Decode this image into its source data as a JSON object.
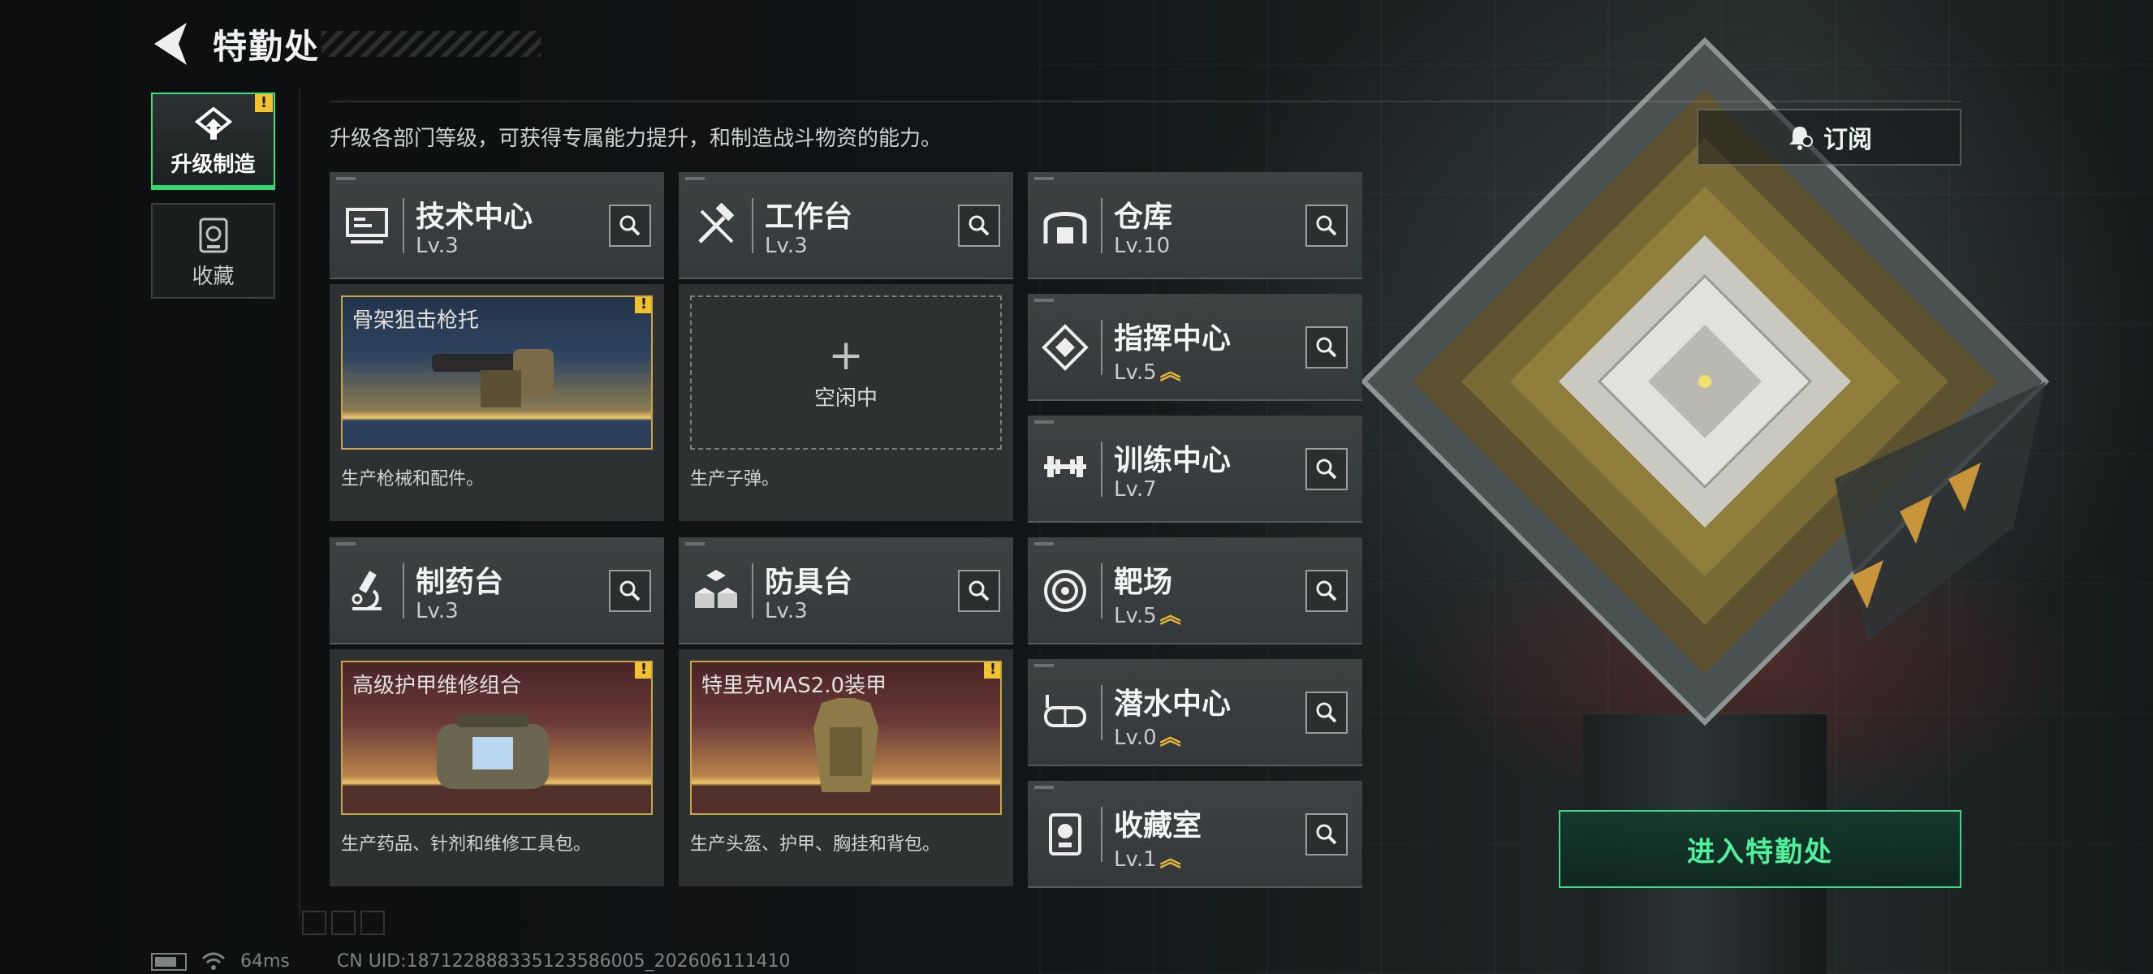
{
  "header": {
    "title": "特勤处"
  },
  "nav": {
    "items": [
      {
        "label": "升级制造",
        "active": true,
        "alert": "!"
      },
      {
        "label": "收藏",
        "active": false
      }
    ]
  },
  "subtitle": "升级各部门等级，可获得专属能力提升，和制造战斗物资的能力。",
  "subscribe": {
    "label": "订阅"
  },
  "departments": [
    {
      "name": "技术中心",
      "level": "Lv.3",
      "upgrade": "",
      "icon": "computer-icon"
    },
    {
      "name": "工作台",
      "level": "Lv.3",
      "upgrade": "",
      "icon": "tools-icon"
    },
    {
      "name": "仓库",
      "level": "Lv.10",
      "upgrade": "",
      "icon": "warehouse-icon"
    },
    {
      "name": "指挥中心",
      "level": "Lv.5",
      "upgrade": "︽",
      "icon": "chip-icon"
    },
    {
      "name": "训练中心",
      "level": "Lv.7",
      "upgrade": "",
      "icon": "dumbbell-icon"
    },
    {
      "name": "制药台",
      "level": "Lv.3",
      "upgrade": "",
      "icon": "microscope-icon"
    },
    {
      "name": "防具台",
      "level": "Lv.3",
      "upgrade": "",
      "icon": "cubes-icon"
    },
    {
      "name": "靶场",
      "level": "Lv.5",
      "upgrade": "︽",
      "icon": "target-icon"
    },
    {
      "name": "潜水中心",
      "level": "Lv.0",
      "upgrade": "︽",
      "icon": "diving-mask-icon"
    },
    {
      "name": "收藏室",
      "level": "Lv.1",
      "upgrade": "︽",
      "icon": "collection-icon"
    }
  ],
  "production": [
    {
      "item": "骨架狙击枪托",
      "desc": "生产枪械和配件。",
      "alert": "!"
    },
    {
      "idle_label": "空闲中",
      "idle_plus": "+",
      "desc": "生产子弹。"
    },
    {
      "item": "高级护甲维修组合",
      "desc": "生产药品、针剂和维修工具包。",
      "alert": "!"
    },
    {
      "item": "特里克MAS2.0装甲",
      "desc": "生产头盔、护甲、胸挂和背包。",
      "alert": "!"
    }
  ],
  "enter_button": {
    "label": "进入特勤处"
  },
  "footer": {
    "ping": "64ms",
    "uid": "CN UID:18712288833512358600​5_202606111410"
  },
  "colors": {
    "accent": "#3fd889",
    "warning": "#f2c230",
    "upgrade": "#e8b838"
  }
}
